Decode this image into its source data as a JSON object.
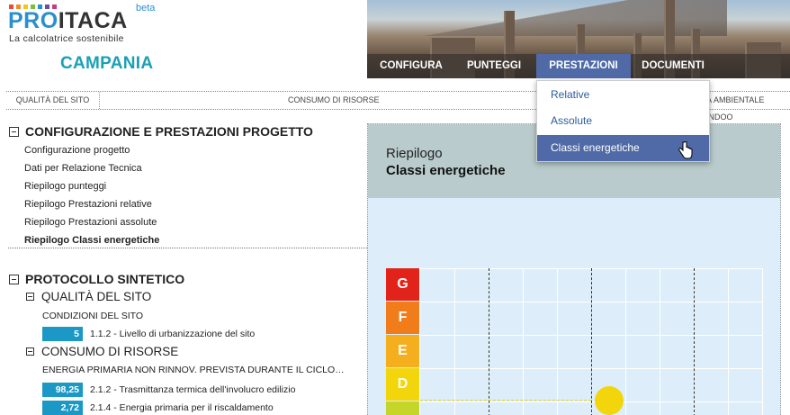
{
  "header": {
    "brand_pro": "PRO",
    "brand_itaca": "ITACA",
    "beta": "beta",
    "tagline": "La calcolatrice sostenibile",
    "region": "CAMPANIA",
    "logo_dot_colors": [
      "#e94b3c",
      "#f28c28",
      "#f5c518",
      "#7cbd3b",
      "#2a8fce",
      "#6a4fa1",
      "#c33c8c"
    ]
  },
  "nav": {
    "items": [
      {
        "label": "CONFIGURA"
      },
      {
        "label": "PUNTEGGI"
      },
      {
        "label": "PRESTAZIONI"
      },
      {
        "label": "DOCUMENTI"
      }
    ],
    "active_index": 2,
    "active_color": "#4f6aa6"
  },
  "tabs": [
    {
      "label": "QUALITÀ DEL SITO"
    },
    {
      "label": "CONSUMO DI RISORSE"
    },
    {
      "label": "À AMBIENTALE INDOO"
    }
  ],
  "dropdown": {
    "options": [
      {
        "label": "Relative"
      },
      {
        "label": "Assolute"
      },
      {
        "label": "Classi energetiche"
      }
    ],
    "selected_index": 2
  },
  "left": {
    "section1": {
      "title": "CONFIGURAZIONE E PRESTAZIONI PROGETTO",
      "links": [
        {
          "label": "Configurazione progetto"
        },
        {
          "label": "Dati per Relazione Tecnica"
        },
        {
          "label": "Riepilogo punteggi"
        },
        {
          "label": "Riepilogo Prestazioni relative"
        },
        {
          "label": "Riepilogo Prestazioni assolute"
        },
        {
          "label": "Riepilogo Classi energetiche"
        }
      ],
      "active_link_index": 5
    },
    "section2": {
      "title": "PROTOCOLLO SINTETICO",
      "sub1": {
        "title": "QUALITÀ DEL SITO",
        "category": "CONDIZIONI DEL SITO",
        "rows": [
          {
            "score": "5",
            "label": "1.1.2 - Livello di urbanizzazione del sito"
          }
        ]
      },
      "sub2": {
        "title": "CONSUMO DI RISORSE",
        "category": "ENERGIA PRIMARIA NON RINNOV. PREVISTA DURANTE IL CICLO…",
        "rows": [
          {
            "score": "98,25",
            "label": "2.1.2 - Trasmittanza termica dell'involucro edilizio"
          },
          {
            "score": "2,72",
            "label": "2.1.4 - Energia primaria per il riscaldamento"
          }
        ]
      }
    }
  },
  "right": {
    "title": "Riepilogo",
    "subtitle": "Classi energetiche",
    "classes": [
      {
        "label": "G",
        "color": "#e2231a"
      },
      {
        "label": "F",
        "color": "#f07d1a"
      },
      {
        "label": "E",
        "color": "#f5ae1e"
      },
      {
        "label": "D",
        "color": "#f2d50b"
      },
      {
        "label": "",
        "color": "#c5d62b"
      }
    ],
    "marker_class": "D"
  }
}
